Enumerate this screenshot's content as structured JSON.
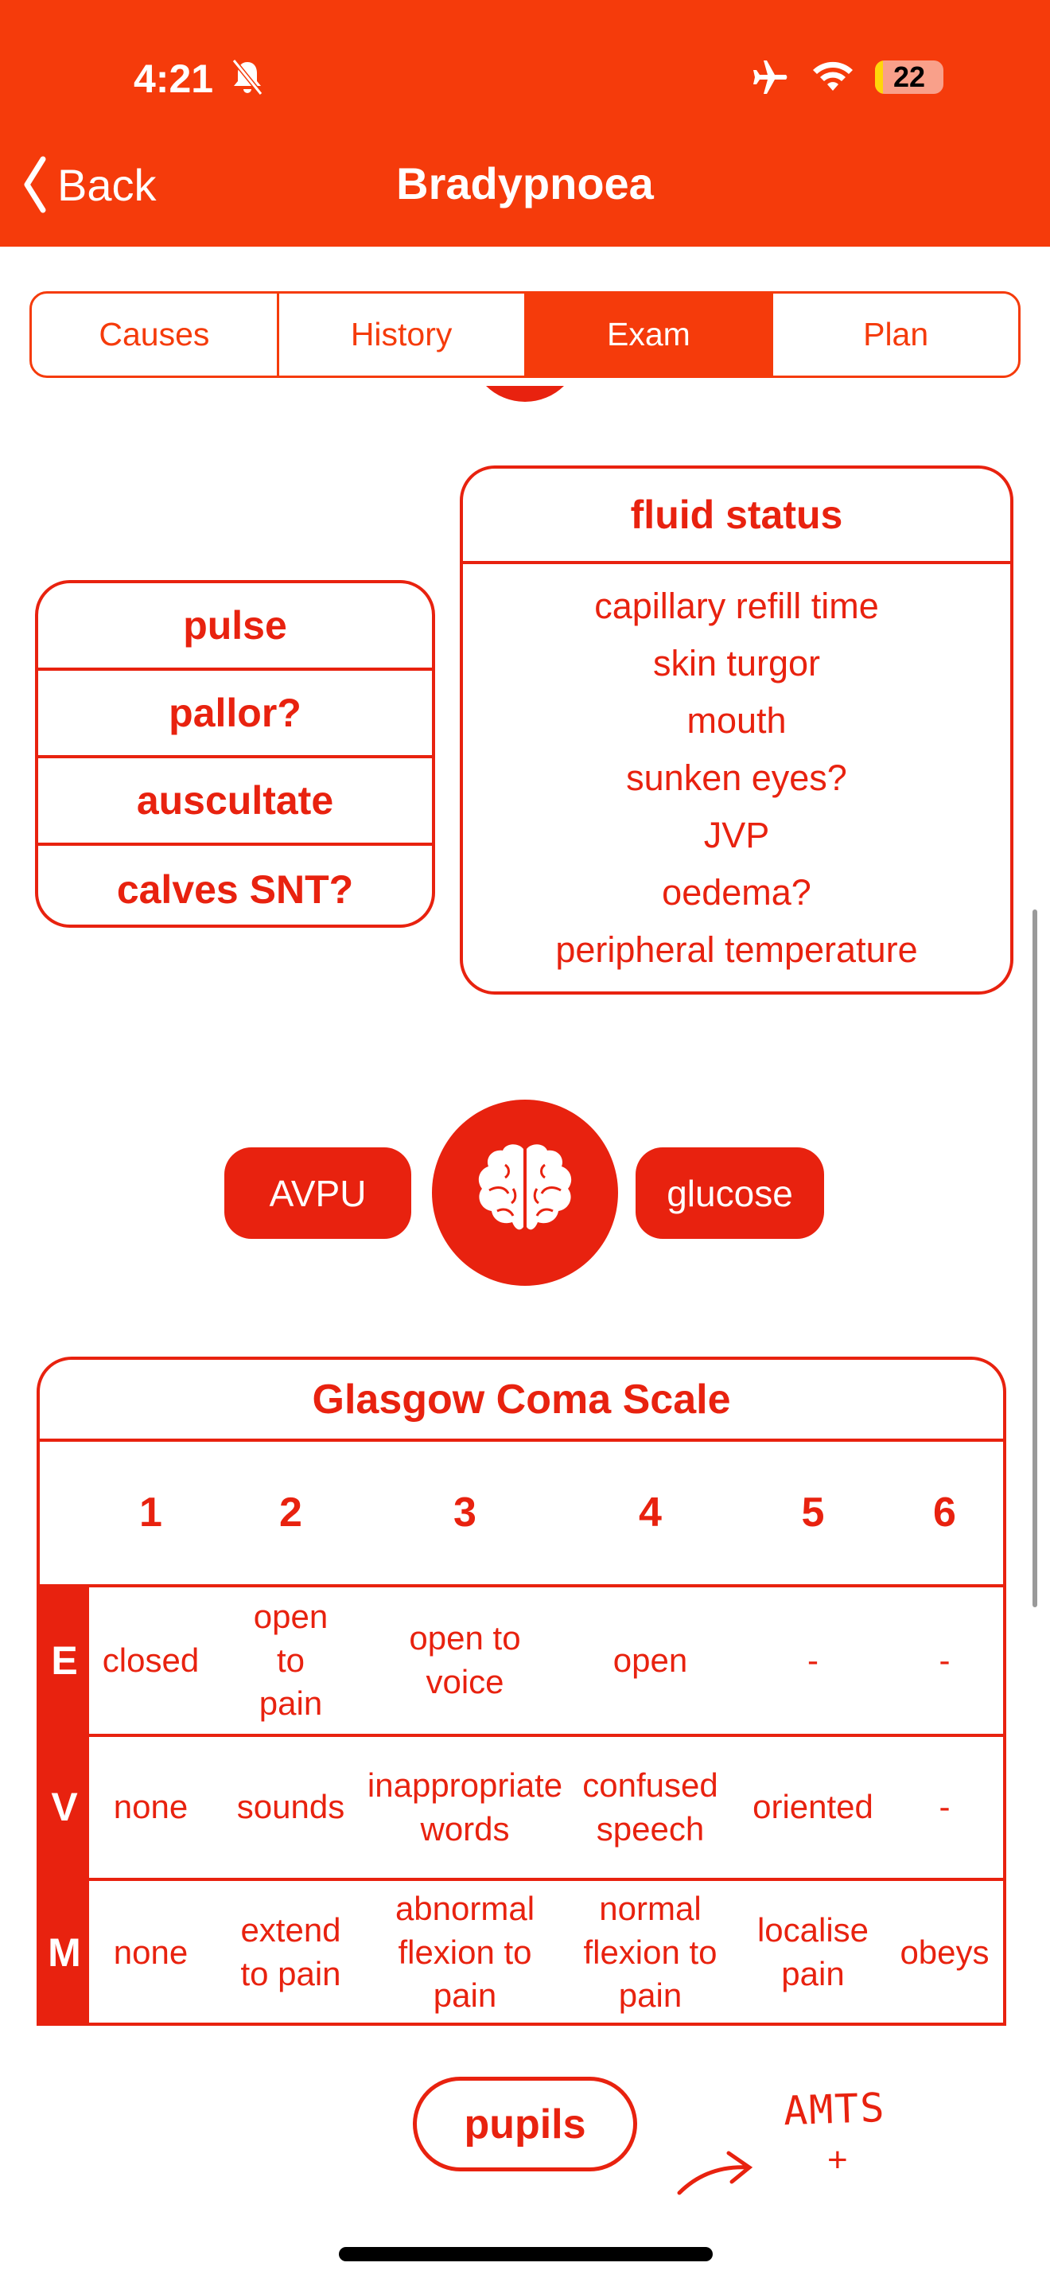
{
  "status": {
    "time": "4:21",
    "battery": "22"
  },
  "nav": {
    "back": "Back",
    "title": "Bradypnoea"
  },
  "tabs": [
    {
      "label": "Causes"
    },
    {
      "label": "History"
    },
    {
      "label": "Exam"
    },
    {
      "label": "Plan"
    }
  ],
  "left_box": [
    "pulse",
    "pallor?",
    "auscultate",
    "calves SNT?"
  ],
  "fluid": {
    "title": "fluid status",
    "items": [
      "capillary refill time",
      "skin turgor",
      "mouth",
      "sunken eyes?",
      "JVP",
      "oedema?",
      "peripheral temperature"
    ]
  },
  "neuro": {
    "avpu": "AVPU",
    "glucose": "glucose"
  },
  "gcs": {
    "title": "Glasgow Coma Scale",
    "scores": [
      "1",
      "2",
      "3",
      "4",
      "5",
      "6"
    ],
    "rows": [
      {
        "label": "E",
        "cells": [
          "closed",
          "open to pain",
          "open to voice",
          "open",
          "-",
          "-"
        ]
      },
      {
        "label": "V",
        "cells": [
          "none",
          "sounds",
          "inappropriate words",
          "confused speech",
          "oriented",
          "-"
        ]
      },
      {
        "label": "M",
        "cells": [
          "none",
          "extend to pain",
          "abnormal flexion to pain",
          "normal flexion to pain",
          "localise pain",
          "obeys"
        ]
      }
    ]
  },
  "pupils": "pupils",
  "handwritten": {
    "text": "AMTS",
    "plus": "+"
  },
  "colors": {
    "header": "#F53B0B",
    "accent": "#E8220F"
  }
}
